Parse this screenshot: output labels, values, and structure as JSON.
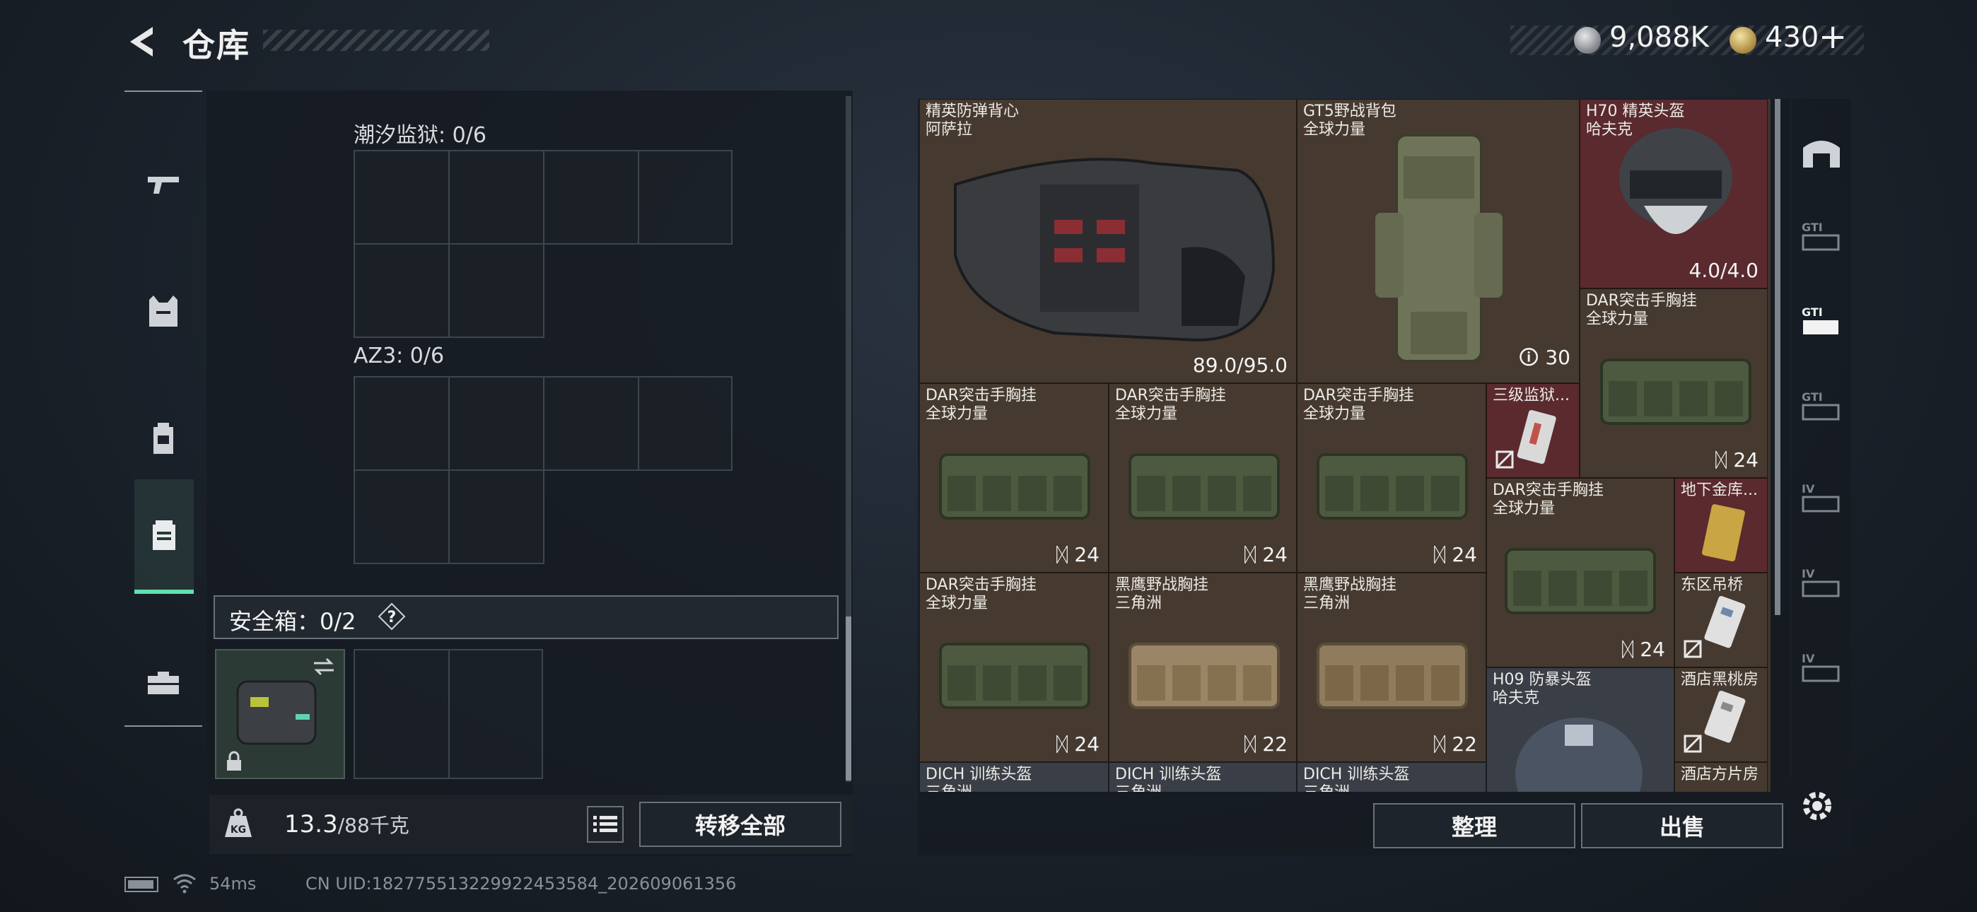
{
  "header": {
    "title": "仓库",
    "currency": [
      {
        "name": "silver-coin",
        "value": "9,088K"
      },
      {
        "name": "gold-coin",
        "value": "430"
      }
    ],
    "plus_label": "+"
  },
  "left_nav": {
    "items": [
      "pistol-icon",
      "vest-icon",
      "backpack-icon",
      "container-icon",
      "toolbox-icon"
    ],
    "active_index": 3
  },
  "containers": [
    {
      "label": "潮汐监狱: 0/6"
    },
    {
      "label": "AZ3: 0/6"
    }
  ],
  "safebox": {
    "label": "安全箱：0/2",
    "help": "?"
  },
  "weight": {
    "current": "13.3",
    "max": "/88千克"
  },
  "actions": {
    "transfer_all": "转移全部",
    "sort": "整理",
    "sell": "出售"
  },
  "items": [
    {
      "name": "精英防弹背心\n阿萨拉",
      "badge": "89.0/95.0"
    },
    {
      "name": "GT5野战背包\n全球力量",
      "badge": "30"
    },
    {
      "name": "H70 精英头盔\n哈夫克",
      "badge": "4.0/4.0"
    },
    {
      "name": "DAR突击手胸挂\n全球力量",
      "badge": "24"
    },
    {
      "name": "DAR突击手胸挂\n全球力量",
      "badge": "24"
    },
    {
      "name": "DAR突击手胸挂\n全球力量",
      "badge": "24"
    },
    {
      "name": "DAR突击手胸挂\n全球力量",
      "badge": "24"
    },
    {
      "name": "三级监狱...",
      "badge": ""
    },
    {
      "name": "DAR突击手胸挂\n全球力量",
      "badge": "24"
    },
    {
      "name": "地下金库...",
      "badge": ""
    },
    {
      "name": "DAR突击手胸挂\n全球力量",
      "badge": "24"
    },
    {
      "name": "黑鹰野战胸挂\n三角洲",
      "badge": "22"
    },
    {
      "name": "黑鹰野战胸挂\n三角洲",
      "badge": "22"
    },
    {
      "name": "东区吊桥",
      "badge": ""
    },
    {
      "name": "H09 防暴头盔\n哈夫克",
      "badge": ""
    },
    {
      "name": "酒店黑桃房",
      "badge": ""
    },
    {
      "name": "DICH 训练头盔\n三角洲",
      "badge": ""
    },
    {
      "name": "DICH 训练头盔\n三角洲",
      "badge": ""
    },
    {
      "name": "DICH 训练头盔\n三角洲",
      "badge": ""
    },
    {
      "name": "酒店方片房",
      "badge": ""
    }
  ],
  "right_nav": [
    "vault-icon",
    "gti-tab-1",
    "gti-tab-2",
    "gti-tab-3",
    "iv-tab-1",
    "iv-tab-2",
    "iv-tab-3"
  ],
  "status": {
    "ping": "54ms",
    "uid": "CN UID:18277551322992245358​4_202609061356"
  },
  "colors": {
    "accent": "#5ee0b0",
    "item_bg": "#463a30",
    "item_rare_bg": "#5a2a2e"
  }
}
